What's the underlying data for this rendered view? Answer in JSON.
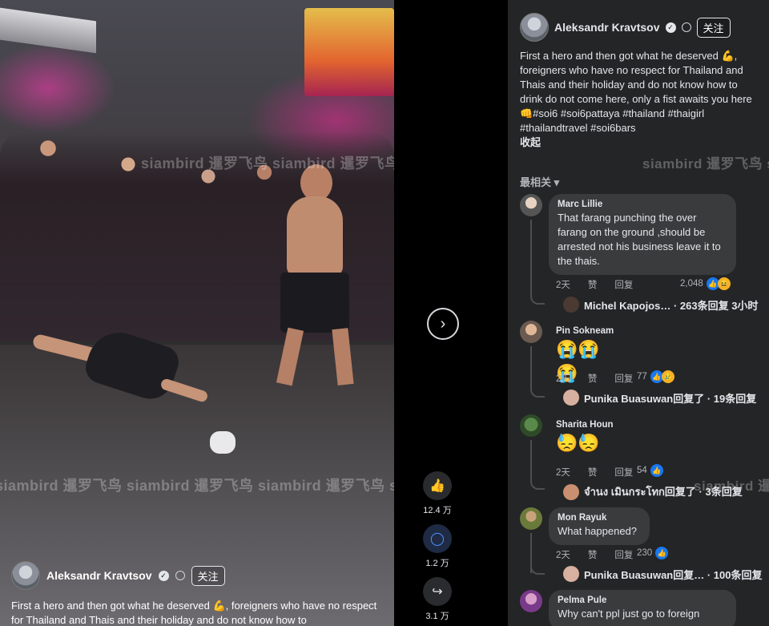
{
  "video": {
    "watermark": "siambird 暹罗飞鸟 siambird 暹罗飞鸟 siambird 暹罗飞鸟 si",
    "author": "Aleksandr Kravtsov",
    "follow_label": "关注",
    "caption": "First a hero and then got what he deserved 💪, foreigners who have no respect for Thailand and Thais and their holiday and do not know how to"
  },
  "actions": {
    "next_icon": "›",
    "likes": "12.4 万",
    "comments": "1.2 万",
    "shares": "3.1 万"
  },
  "post": {
    "author": "Aleksandr Kravtsov",
    "follow_label": "关注",
    "text": "First a hero and then got what he deserved 💪, foreigners who have no respect for Thailand and Thais and their holiday and do not know how to drink do not come here, only a fist awaits you here 👊#soi6 #soi6pattaya #thailand #thaigirl #thailandtravel #soi6bars",
    "more_label": "收起",
    "sort_label": "最相关 ▾"
  },
  "comments": [
    {
      "author": "Marc Lillie",
      "text": "That farang punching the over farang on the ground ,should be arrested not his business leave it to the thais.",
      "time": "2天",
      "like_label": "赞",
      "reply_label": "回复",
      "reactions": "2,048",
      "reply_preview": "Michel Kapojos… · 263条回复 3小时"
    },
    {
      "author": "Pin Sokneam",
      "emoji": "😭😭😭",
      "time": "2天",
      "like_label": "赞",
      "reply_label": "回复",
      "reactions": "77",
      "reply_preview": "Punika Buasuwan回复了 · 19条回复"
    },
    {
      "author": "Sharita Houn",
      "emoji": "😓😓",
      "time": "2天",
      "like_label": "赞",
      "reply_label": "回复",
      "reactions": "54",
      "reply_preview": "จำนง เมินกระโทก回复了 · 3条回复"
    },
    {
      "author": "Mon Rayuk",
      "text": "What happened?",
      "time": "2天",
      "like_label": "赞",
      "reply_label": "回复",
      "reactions": "230",
      "reply_preview": "Punika Buasuwan回复… · 100条回复"
    },
    {
      "author": "Pelma Pule",
      "text": "Why can't ppl just go to foreign"
    }
  ],
  "colors": {
    "panel_bg": "#242526",
    "bubble_bg": "#3a3b3c",
    "like_blue": "#1877f2"
  }
}
